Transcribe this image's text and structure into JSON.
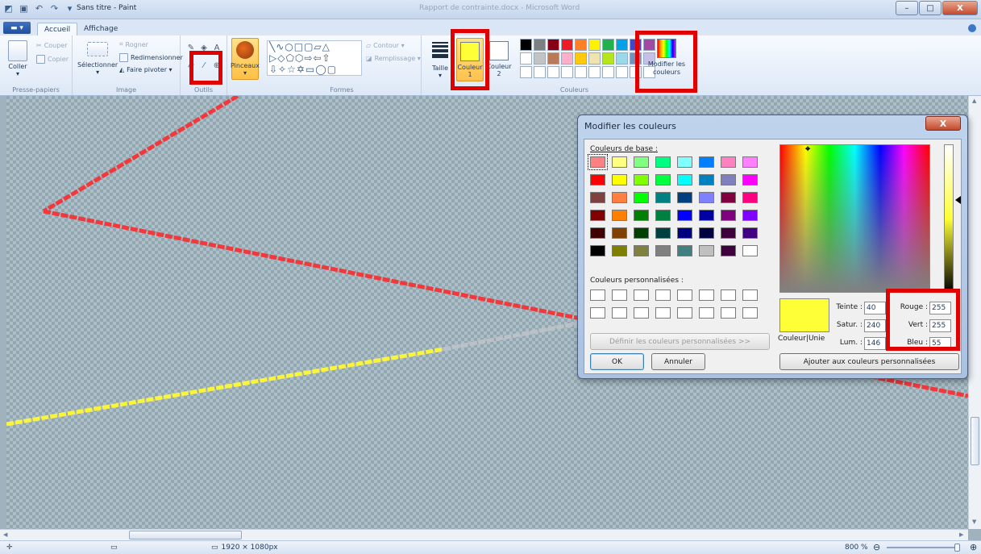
{
  "window": {
    "title": "Sans titre - Paint",
    "background_title": "Rapport de contrainte.docx - Microsoft Word",
    "controls": {
      "minimize": "–",
      "maximize": "□",
      "close": "X"
    }
  },
  "qat": {
    "icons": [
      "paint-app-icon",
      "save-icon",
      "undo-icon",
      "redo-icon",
      "customize-dropdown-icon"
    ]
  },
  "tabs": {
    "file": "▬ ▾",
    "home": "Accueil",
    "view": "Affichage"
  },
  "ribbon": {
    "clipboard": {
      "label": "Presse-papiers",
      "paste": "Coller",
      "cut": "Couper",
      "copy": "Copier"
    },
    "image": {
      "label": "Image",
      "select": "Sélectionner",
      "crop": "Rogner",
      "resize": "Redimensionner",
      "rotate": "Faire pivoter ▾"
    },
    "tools": {
      "label": "Outils"
    },
    "brushes": {
      "label": "Pinceaux"
    },
    "shapes": {
      "label": "Formes",
      "outline": "Contour ▾",
      "fill": "Remplissage ▾",
      "glyphs": "╲∿○□▢▱△ ▷◇⬠⬡⇨⇦⇧ ⇩✧☆✡▭◯▢"
    },
    "size": {
      "label": "Taille"
    },
    "colors": {
      "label": "Couleurs",
      "color1": "Couleur 1",
      "color1_hex": "#ffff37",
      "color2": "Couleur 2",
      "color2_hex": "#ffffff",
      "edit": "Modifier les couleurs",
      "palette": [
        "#000000",
        "#7f7f7f",
        "#880015",
        "#ed1c24",
        "#ff7f27",
        "#fff200",
        "#22b14c",
        "#00a2e8",
        "#3f48cc",
        "#a349a4",
        "#ffffff",
        "#c3c3c3",
        "#b97a57",
        "#ffaec9",
        "#ffc90e",
        "#efe4b0",
        "#b5e61d",
        "#99d9ea",
        "#7092be",
        "#c8bfe7",
        "#ffffff",
        "#ffffff",
        "#ffffff",
        "#ffffff",
        "#ffffff",
        "#ffffff",
        "#ffffff",
        "#ffffff",
        "#ffffff",
        "#ffffff"
      ]
    }
  },
  "dialog": {
    "title": "Modifier les couleurs",
    "basic_label": "Couleurs de base :",
    "custom_label": "Couleurs personnalisées :",
    "define_btn": "Définir les couleurs personnalisées >>",
    "ok": "OK",
    "cancel": "Annuler",
    "add_btn": "Ajouter aux couleurs personnalisées",
    "solid_label": "Couleur|Unie",
    "hue_label": "Teinte :",
    "hue": "40",
    "sat_label": "Satur. :",
    "sat": "240",
    "lum_label": "Lum. :",
    "lum": "146",
    "red_label": "Rouge :",
    "red": "255",
    "green_label": "Vert :",
    "green": "255",
    "blue_label": "Bleu :",
    "blue": "55",
    "preview_hex": "#ffff37",
    "basic_colors": [
      "#ff8080",
      "#ffff80",
      "#80ff80",
      "#00ff80",
      "#80ffff",
      "#0080ff",
      "#ff80c0",
      "#ff80ff",
      "#ff0000",
      "#ffff00",
      "#80ff00",
      "#00ff40",
      "#00ffff",
      "#0080c0",
      "#8080c0",
      "#ff00ff",
      "#804040",
      "#ff8040",
      "#00ff00",
      "#008080",
      "#004080",
      "#8080ff",
      "#800040",
      "#ff0080",
      "#800000",
      "#ff8000",
      "#008000",
      "#008040",
      "#0000ff",
      "#0000a0",
      "#800080",
      "#8000ff",
      "#400000",
      "#804000",
      "#004000",
      "#004040",
      "#000080",
      "#000040",
      "#400040",
      "#400080",
      "#000000",
      "#808000",
      "#808040",
      "#808080",
      "#408080",
      "#c0c0c0",
      "#400040",
      "#ffffff"
    ]
  },
  "status": {
    "size": "1920 × 1080px",
    "zoom": "800 %"
  }
}
